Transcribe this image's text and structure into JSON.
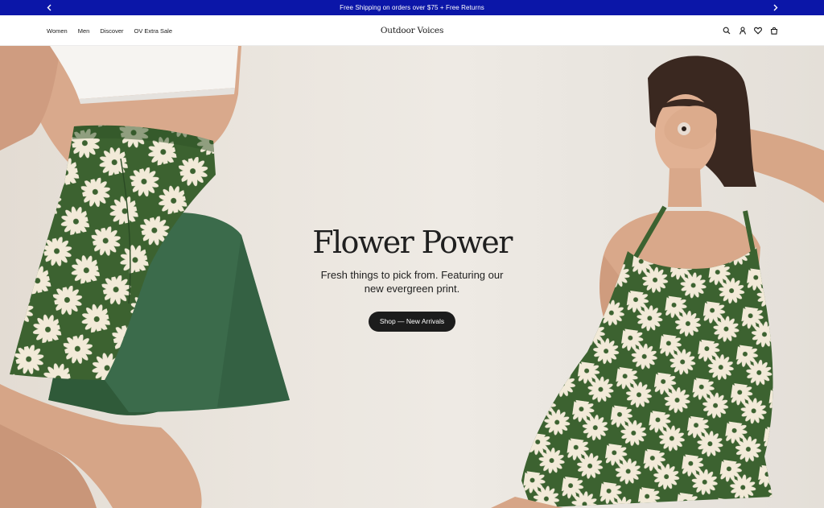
{
  "announcement": {
    "text": "Free Shipping on orders over $75 + Free Returns",
    "prev_icon": "chevron-left-icon",
    "next_icon": "chevron-right-icon"
  },
  "header": {
    "nav": [
      "Women",
      "Men",
      "Discover",
      "OV Extra Sale"
    ],
    "logo": "Outdoor Voices",
    "icons": [
      "search-icon",
      "account-icon",
      "heart-icon",
      "bag-icon"
    ]
  },
  "hero": {
    "title": "Flower Power",
    "subtitle": "Fresh things to pick from. Featuring our new evergreen print.",
    "cta": "Shop — New Arrivals"
  },
  "colors": {
    "announcement_bg": "#0b16a8",
    "cta_bg": "#1c1c1c",
    "print_green": "#3c6230"
  }
}
